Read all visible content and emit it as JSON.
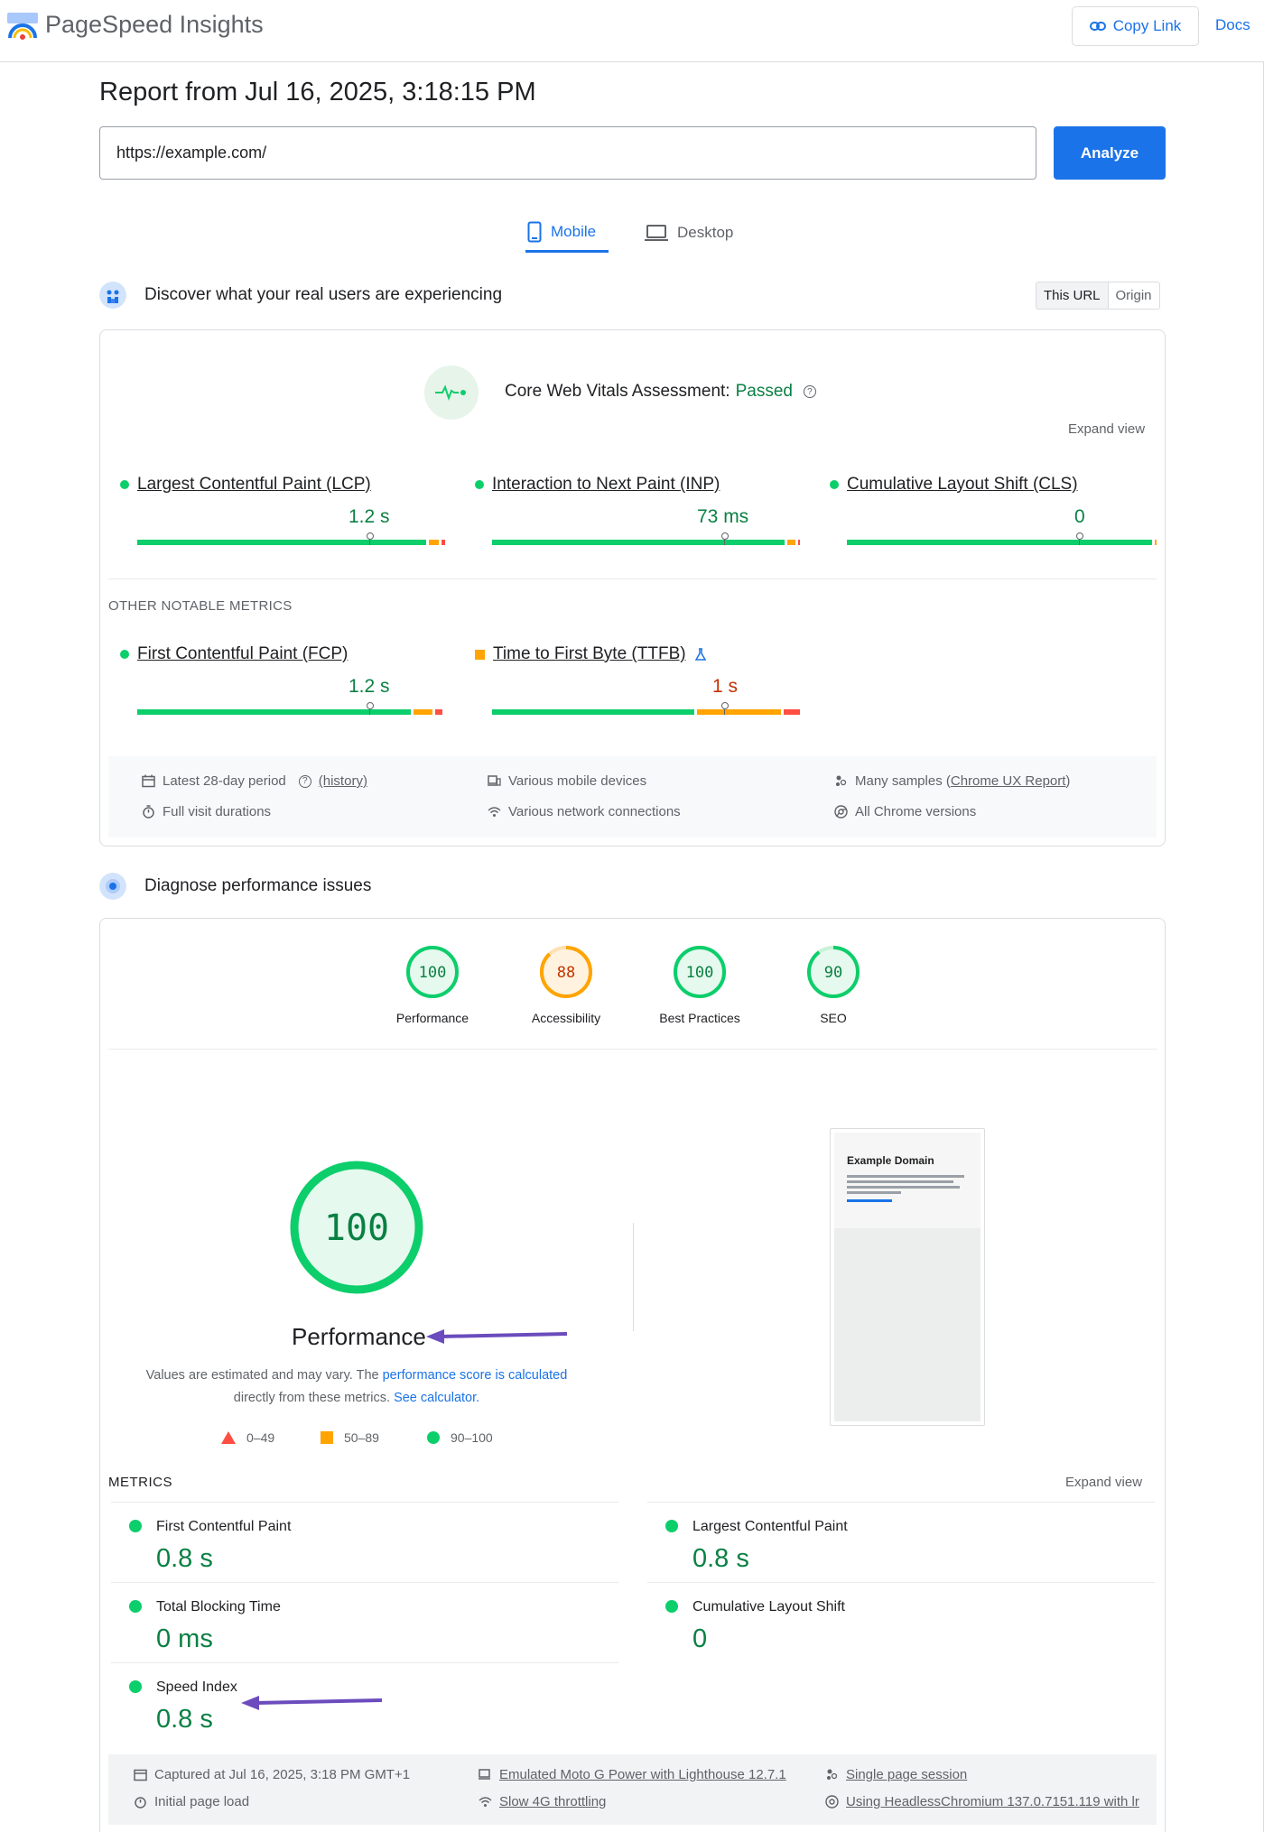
{
  "app": {
    "title": "PageSpeed Insights"
  },
  "header": {
    "copy_link": "Copy Link",
    "docs": "Docs"
  },
  "report": {
    "title": "Report from Jul 16, 2025, 3:18:15 PM"
  },
  "search": {
    "value": "https://example.com/",
    "analyze_label": "Analyze"
  },
  "tabs": [
    {
      "label": "Mobile",
      "active": true
    },
    {
      "label": "Desktop",
      "active": false
    }
  ],
  "field": {
    "heading": "Discover what your real users are experiencing",
    "toggle": [
      "This URL",
      "Origin"
    ],
    "assessment_label": "Core Web Vitals Assessment:",
    "assessment_status": "Passed",
    "expand_view": "Expand view",
    "core_metrics": [
      {
        "label": "Largest Contentful Paint (LCP)",
        "value": "1.2 s",
        "rating": "good",
        "distribution": [
          0.94,
          0.04,
          0.02
        ],
        "marker": 0.75
      },
      {
        "label": "Interaction to Next Paint (INP)",
        "value": "73 ms",
        "rating": "good",
        "distribution": [
          0.95,
          0.035,
          0.015
        ],
        "marker": 0.75
      },
      {
        "label": "Cumulative Layout Shift (CLS)",
        "value": "0",
        "rating": "good",
        "distribution": [
          0.99,
          0.01,
          0.0
        ],
        "marker": 0.75
      }
    ],
    "other_heading": "OTHER NOTABLE METRICS",
    "other_metrics": [
      {
        "label": "First Contentful Paint (FCP)",
        "value": "1.2 s",
        "rating": "good",
        "distribution": [
          0.89,
          0.07,
          0.03
        ],
        "marker": 0.75
      },
      {
        "label": "Time to First Byte (TTFB)",
        "value": "1 s",
        "rating": "average",
        "distribution": [
          0.66,
          0.28,
          0.06
        ],
        "marker": 0.75
      }
    ],
    "info": {
      "period": "Latest 28-day period",
      "history": "(history)",
      "devices": "Various mobile devices",
      "samples_prefix": "Many samples (",
      "samples_link": "Chrome UX Report",
      "samples_suffix": ")",
      "durations": "Full visit durations",
      "network": "Various network connections",
      "chrome": "All Chrome versions"
    }
  },
  "lab": {
    "heading": "Diagnose performance issues",
    "scores": [
      {
        "label": "Performance",
        "value": 100,
        "color": "#0cce6b"
      },
      {
        "label": "Accessibility",
        "value": 88,
        "color": "#ffa400"
      },
      {
        "label": "Best Practices",
        "value": 100,
        "color": "#0cce6b"
      },
      {
        "label": "SEO",
        "value": 90,
        "color": "#0cce6b"
      }
    ],
    "big_score": {
      "value": "100",
      "label": "Performance"
    },
    "note": {
      "part1": "Values are estimated and may vary. The ",
      "link1": "performance score is calculated",
      "part2": "directly from these metrics. ",
      "link2": "See calculator."
    },
    "legend": [
      "0–49",
      "50–89",
      "90–100"
    ],
    "screenshot": {
      "title": "Example Domain"
    },
    "metrics_heading": "METRICS",
    "expand_view": "Expand view",
    "metrics": [
      {
        "label": "First Contentful Paint",
        "value": "0.8 s"
      },
      {
        "label": "Largest Contentful Paint",
        "value": "0.8 s"
      },
      {
        "label": "Total Blocking Time",
        "value": "0 ms"
      },
      {
        "label": "Cumulative Layout Shift",
        "value": "0"
      },
      {
        "label": "Speed Index",
        "value": "0.8 s"
      }
    ],
    "info": {
      "captured": "Captured at Jul 16, 2025, 3:18 PM GMT+1",
      "device": "Emulated Moto G Power with Lighthouse 12.7.1",
      "session": "Single page session",
      "load": "Initial page load",
      "throttling": "Slow 4G throttling",
      "browser": "Using HeadlessChromium 137.0.7151.119 with lr"
    }
  },
  "colors": {
    "good": "#0cce6b",
    "average": "#ffa400",
    "poor": "#ff4e42",
    "accent": "#1a73e8",
    "annotation": "#6b4bbd"
  }
}
